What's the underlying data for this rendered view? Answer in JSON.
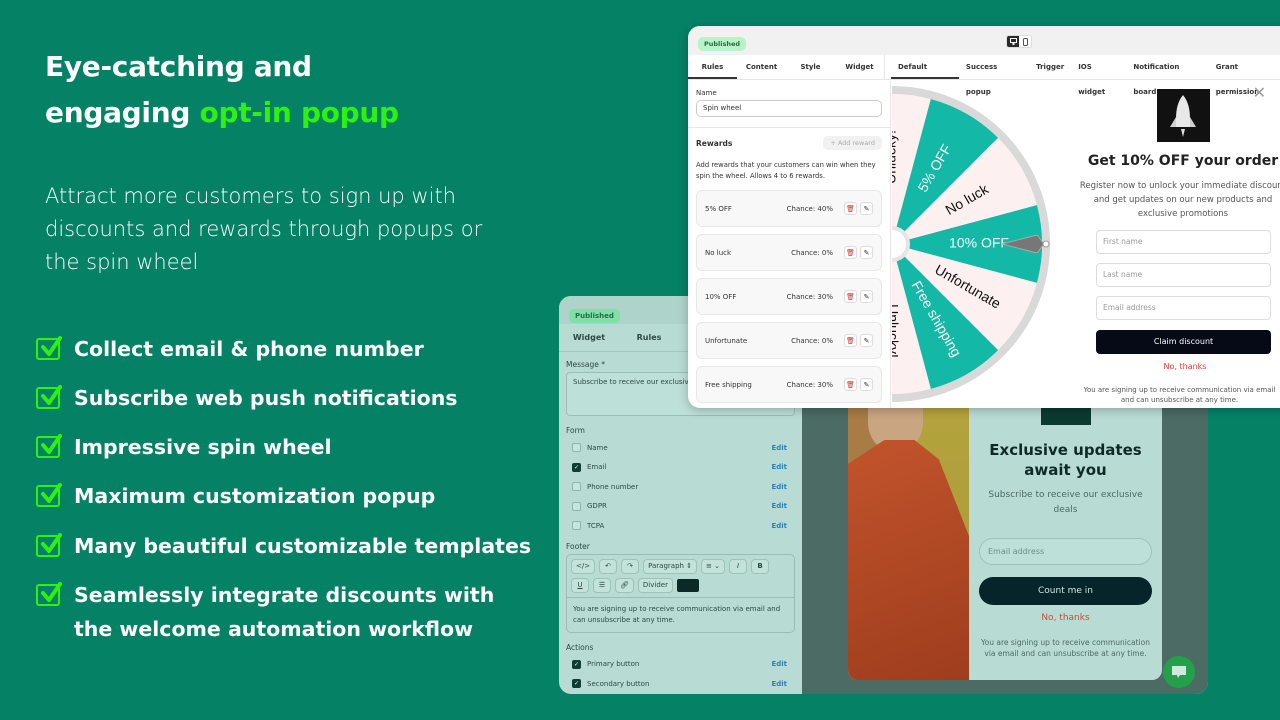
{
  "hero": {
    "title_line1": "Eye-catching and",
    "title_line2_plain": "engaging ",
    "title_line2_accent": "opt-in popup",
    "accent_color": "#2ef20d",
    "background_color": "#058266",
    "subtitle": "Attract more customers to sign up with discounts and rewards through popups or the spin wheel"
  },
  "features": [
    {
      "icon": "checkbox-check-icon",
      "text": "Collect email & phone number"
    },
    {
      "icon": "checkbox-check-icon",
      "text": "Subscribe web push notifications"
    },
    {
      "icon": "checkbox-check-icon",
      "text": "Impressive spin wheel"
    },
    {
      "icon": "checkbox-check-icon",
      "text": "Maximum customization popup"
    },
    {
      "icon": "checkbox-check-icon",
      "text": "Many beautiful customizable templates"
    },
    {
      "icon": "checkbox-check-icon",
      "text": "Seamlessly integrate discounts with the welcome automation workflow"
    }
  ],
  "front_window": {
    "status_badge": "Published",
    "device_toggle": [
      "desktop-icon",
      "mobile-icon"
    ],
    "left_tabs": [
      "Rules",
      "Content",
      "Style",
      "Widget"
    ],
    "active_left_tab": "Rules",
    "right_tabs": [
      "Default popup",
      "Success popup",
      "Trigger",
      "IOS widget",
      "Notification board",
      "Grant permission"
    ],
    "active_right_tab": "Default popup",
    "name_label": "Name",
    "name_value": "Spin wheel",
    "rewards_title": "Rewards",
    "add_reward_label": "+ Add reward",
    "rewards_desc": "Add rewards that your customers can win when they spin the wheel. Allows 4 to 6 rewards.",
    "rewards": [
      {
        "name": "5% OFF",
        "chance": "Chance: 40%"
      },
      {
        "name": "No luck",
        "chance": "Chance: 0%"
      },
      {
        "name": "10% OFF",
        "chance": "Chance: 30%"
      },
      {
        "name": "Unfortunate",
        "chance": "Chance: 0%"
      },
      {
        "name": "Free shipping",
        "chance": "Chance: 30%"
      }
    ],
    "wheel_segments": [
      "Unlucky!",
      "5% OFF",
      "No luck",
      "10% OFF",
      "Unfortunate",
      "Free shipping",
      "Unlucky!"
    ],
    "wheel_colors": {
      "teal": "#14b8a6",
      "pink": "#fdf0f0",
      "rim": "#d9d9d9"
    },
    "popup": {
      "title": "Get 10% OFF your order",
      "description": "Register now to unlock your immediate discount and get updates on our new products and exclusive promotions",
      "first_name_placeholder": "First name",
      "last_name_placeholder": "Last name",
      "email_placeholder": "Email address",
      "claim_label": "Claim discount",
      "no_thanks_label": "No, thanks",
      "footer": "You are signing up to receive communication via email and can unsubscribe at any time."
    }
  },
  "back_window": {
    "status_badge": "Published",
    "tabs": [
      "Widget",
      "Rules"
    ],
    "message_label": "Message *",
    "message_value": "Subscribe to receive our exclusive",
    "form_label": "Form",
    "form_fields": [
      {
        "label": "Name",
        "checked": false,
        "edit": "Edit"
      },
      {
        "label": "Email",
        "checked": true,
        "edit": "Edit"
      },
      {
        "label": "Phone number",
        "checked": false,
        "edit": "Edit"
      },
      {
        "label": "GDPR",
        "checked": false,
        "edit": "Edit"
      },
      {
        "label": "TCPA",
        "checked": false,
        "edit": "Edit"
      }
    ],
    "footer_label": "Footer",
    "toolbar": {
      "paragraph": "Paragraph",
      "divider": "Divider",
      "bold": "B",
      "italic": "I",
      "underline": "U"
    },
    "footer_text": "You are signing up to receive communication via email and can unsubscribe at any time.",
    "actions_label": "Actions",
    "actions": [
      {
        "label": "Primary button",
        "checked": true,
        "edit": "Edit"
      },
      {
        "label": "Secondary button",
        "checked": true,
        "edit": "Edit"
      }
    ],
    "popup": {
      "title": "Exclusive updates await you",
      "description": "Subscribe to receive our exclusive deals",
      "email_placeholder": "Email address",
      "cta_label": "Count me in",
      "no_thanks_label": "No, thanks",
      "footer": "You are signing up to receive communication via email and can unsubscribe at any time."
    }
  }
}
